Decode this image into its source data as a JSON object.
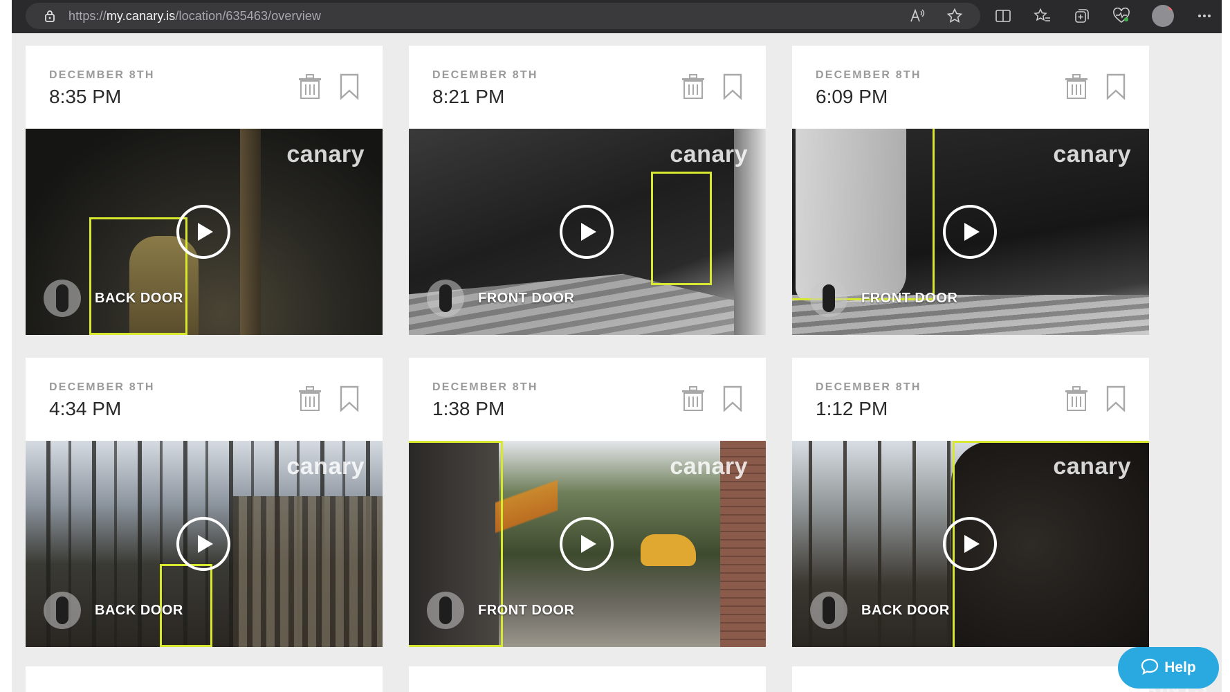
{
  "browser": {
    "url_prefix": "https://",
    "url_host": "my.canary.is",
    "url_path": "/location/635463/overview",
    "icons": [
      "lock-icon",
      "read-aloud-icon",
      "favorite-star-icon",
      "split-screen-icon",
      "favorites-icon",
      "collections-icon",
      "browser-essentials-icon",
      "profile-avatar",
      "more-menu-icon"
    ]
  },
  "brand_watermark": "canary",
  "events": [
    {
      "date": "DECEMBER 8TH",
      "time": "8:35 PM",
      "camera": "BACK DOOR"
    },
    {
      "date": "DECEMBER 8TH",
      "time": "8:21 PM",
      "camera": "FRONT DOOR"
    },
    {
      "date": "DECEMBER 8TH",
      "time": "6:09 PM",
      "camera": "FRONT DOOR"
    },
    {
      "date": "DECEMBER 8TH",
      "time": "4:34 PM",
      "camera": "BACK DOOR"
    },
    {
      "date": "DECEMBER 8TH",
      "time": "1:38 PM",
      "camera": "FRONT DOOR"
    },
    {
      "date": "DECEMBER 8TH",
      "time": "1:12 PM",
      "camera": "BACK DOOR"
    }
  ],
  "help_button": {
    "label": "Help"
  },
  "overlay_watermark": "COMPLAINTS",
  "colors": {
    "detection_box": "#d7e82e",
    "help": "#29a9e0",
    "chrome": "#2a2a2c",
    "page_bg": "#ececec"
  }
}
